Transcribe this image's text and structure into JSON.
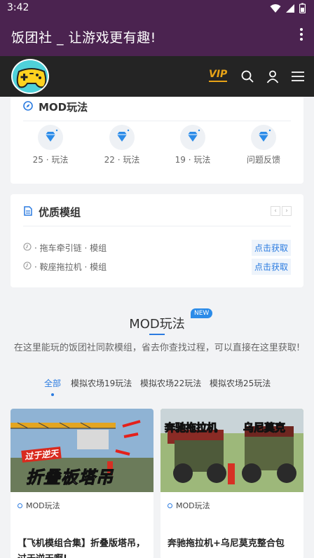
{
  "status": {
    "time": "3:42"
  },
  "appbar": {
    "title": "饭团社 _ 让游戏更有趣!"
  },
  "site": {
    "vip_label": "VIP"
  },
  "mod_play_card": {
    "title": "MOD玩法",
    "items": [
      {
        "label": "25 · 玩法"
      },
      {
        "label": "22 · 玩法"
      },
      {
        "label": "19 · 玩法"
      },
      {
        "label": "问题反馈"
      }
    ]
  },
  "quality_card": {
    "title": "优质模组",
    "rows": [
      {
        "name": "· 拖车牵引链 · 模组",
        "action": "点击获取"
      },
      {
        "name": "· 鞍座拖拉机 · 模组",
        "action": "点击获取"
      }
    ]
  },
  "section": {
    "title": "MOD玩法",
    "badge": "NEW",
    "desc": "在这里能玩的饭团社同款模组，省去你查找过程，可以直接在这里获取!",
    "tabs": [
      "全部",
      "模拟农场19玩法",
      "模拟农场22玩法",
      "模拟农场25玩法"
    ]
  },
  "posts": [
    {
      "overlay_top": "过于逆天",
      "overlay_main": "折叠板塔吊",
      "category": "MOD玩法",
      "title": "【飞机模组合集】折叠版塔吊，过于逆天啊!"
    },
    {
      "overlay_left": "奔驰拖拉机",
      "overlay_right": "乌尼莫克",
      "category": "MOD玩法",
      "title": "奔驰拖拉机+乌尼莫克整合包"
    }
  ],
  "colors": {
    "appbar": "#4b2350",
    "sitebar": "#242424",
    "accent": "#2b7be0",
    "vip": "#e8a317"
  }
}
